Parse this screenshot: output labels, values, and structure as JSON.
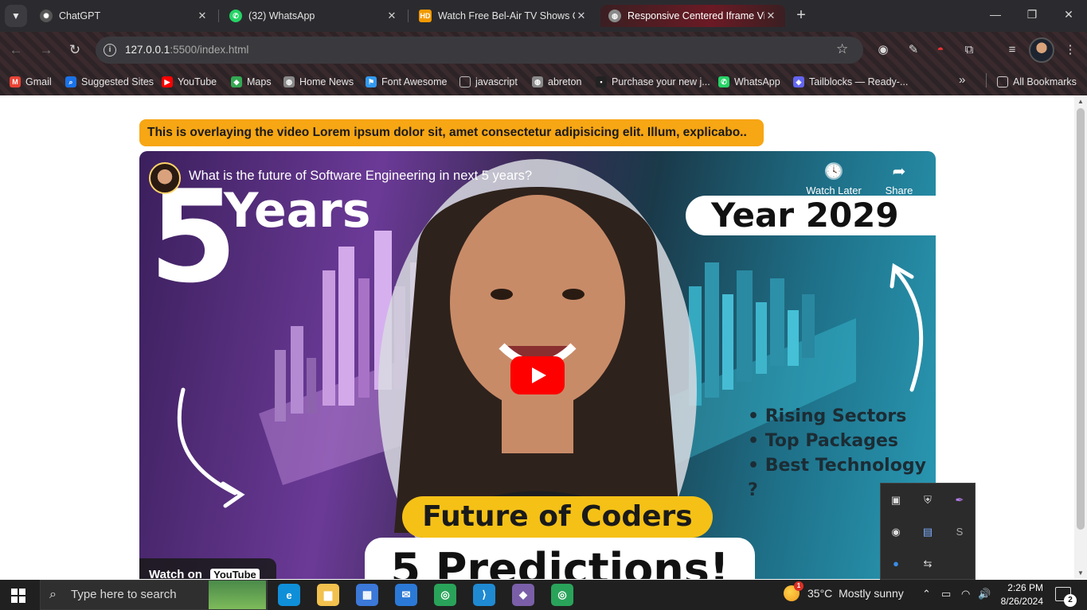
{
  "browser": {
    "tabs": [
      {
        "title": "ChatGPT",
        "icon": "chatgpt-icon"
      },
      {
        "title": "(32) WhatsApp",
        "icon": "whatsapp-icon"
      },
      {
        "title": "Watch Free Bel-Air TV Shows O",
        "icon": "hd-icon",
        "icon_text": "HD"
      },
      {
        "title": "Responsive Centered Iframe Vi",
        "icon": "globe-icon",
        "active": true
      }
    ],
    "url_host": "127.0.0.1",
    "url_path": ":5500/index.html",
    "bookmarks": [
      {
        "label": "Gmail",
        "icon": "gmail-icon",
        "color": "#ea4335"
      },
      {
        "label": "Suggested Sites",
        "icon": "search-icon",
        "color": "#1a73e8"
      },
      {
        "label": "YouTube",
        "icon": "youtube-icon",
        "color": "#ff0000"
      },
      {
        "label": "Maps",
        "icon": "maps-icon",
        "color": "#34a853"
      },
      {
        "label": "Home News",
        "icon": "globe-icon",
        "color": "#8a8a8a"
      },
      {
        "label": "Font Awesome",
        "icon": "flag-icon",
        "color": "#339af0"
      },
      {
        "label": "javascript",
        "icon": "folder-icon",
        "color": "#9a9a9a"
      },
      {
        "label": "abreton",
        "icon": "globe-icon",
        "color": "#8a8a8a"
      },
      {
        "label": "Purchase your new j...",
        "icon": "site-icon",
        "color": "#222222"
      },
      {
        "label": "WhatsApp",
        "icon": "whatsapp-icon",
        "color": "#25d366"
      },
      {
        "label": "Tailblocks — Ready-...",
        "icon": "tailblocks-icon",
        "color": "#6366f1"
      }
    ],
    "all_bookmarks": "All Bookmarks"
  },
  "page": {
    "banner_text": "This is overlaying the video Lorem ipsum dolor sit, amet consectetur adipisicing elit. Illum, explicabo.."
  },
  "video": {
    "title": "What is the future of Software Engineering in next 5 years?",
    "watch_later": "Watch Later",
    "share": "Share",
    "thumb_number": "5",
    "thumb_years": "Years",
    "thumb_year_2029": "Year 2029",
    "thumb_bullets": [
      "Rising Sectors",
      "Top Packages",
      "Best Technology ?"
    ],
    "thumb_future": "Future of  Coders",
    "thumb_predictions": "5 Predictions!",
    "watch_on": "Watch on",
    "youtube_label": "YouTube"
  },
  "taskbar": {
    "search_placeholder": "Type here to search",
    "weather_temp": "35°C",
    "weather_desc": "Mostly sunny",
    "weather_badge": "1",
    "time": "2:26 PM",
    "date": "8/26/2024",
    "notifications": "2",
    "apps": [
      {
        "icon": "edge-icon",
        "color": "#0f8fd8"
      },
      {
        "icon": "file-explorer-icon",
        "color": "#f2c14e"
      },
      {
        "icon": "microsoft-store-icon",
        "color": "#3b78d8"
      },
      {
        "icon": "mail-icon",
        "color": "#2b79d6"
      },
      {
        "icon": "chrome-icon",
        "color": "#2aa35a"
      },
      {
        "icon": "vscode-icon",
        "color": "#1f8ad2"
      },
      {
        "icon": "git-icon",
        "color": "#7a5fa8"
      },
      {
        "icon": "chrome-profile-icon",
        "color": "#2aa35a"
      }
    ]
  }
}
